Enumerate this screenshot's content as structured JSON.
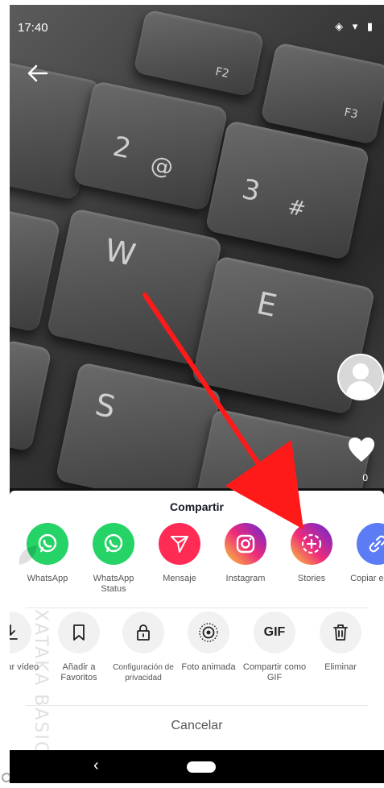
{
  "status_bar": {
    "time": "17:40",
    "icons": "◈ ▾ ▮"
  },
  "video": {
    "like_count": "0"
  },
  "share_sheet": {
    "title": "Compartir",
    "row1": [
      {
        "label": "WhatsApp",
        "icon": "whatsapp-icon",
        "color": "#25D366"
      },
      {
        "label": "WhatsApp Status",
        "icon": "whatsapp-status-icon",
        "color": "#25D366"
      },
      {
        "label": "Mensaje",
        "icon": "message-send-icon",
        "color": "#FE2C55"
      },
      {
        "label": "Instagram",
        "icon": "instagram-icon",
        "color": "#C13584"
      },
      {
        "label": "Stories",
        "icon": "stories-icon",
        "color": "#C13584"
      },
      {
        "label": "Copiar enlace",
        "icon": "link-icon",
        "color": "#5B7CF5"
      }
    ],
    "row2": [
      {
        "label": "Guardar vídeo",
        "icon": "download-icon"
      },
      {
        "label": "Añadir a Favoritos",
        "icon": "bookmark-icon"
      },
      {
        "label": "Configuración de privacidad",
        "icon": "lock-icon"
      },
      {
        "label": "Foto animada",
        "icon": "live-photo-icon"
      },
      {
        "label": "Compartir como GIF",
        "icon": "gif-icon",
        "icon_text": "GIF"
      },
      {
        "label": "Eliminar",
        "icon": "trash-icon"
      }
    ],
    "cancel_label": "Cancelar"
  },
  "keyboard_keys": {
    "w": "W",
    "e": "E",
    "s": "S",
    "two": "2",
    "at": "@",
    "three": "3",
    "hash": "#",
    "f2": "F2",
    "f3": "F3"
  },
  "watermark": {
    "text": "XATAKA BASICS"
  }
}
